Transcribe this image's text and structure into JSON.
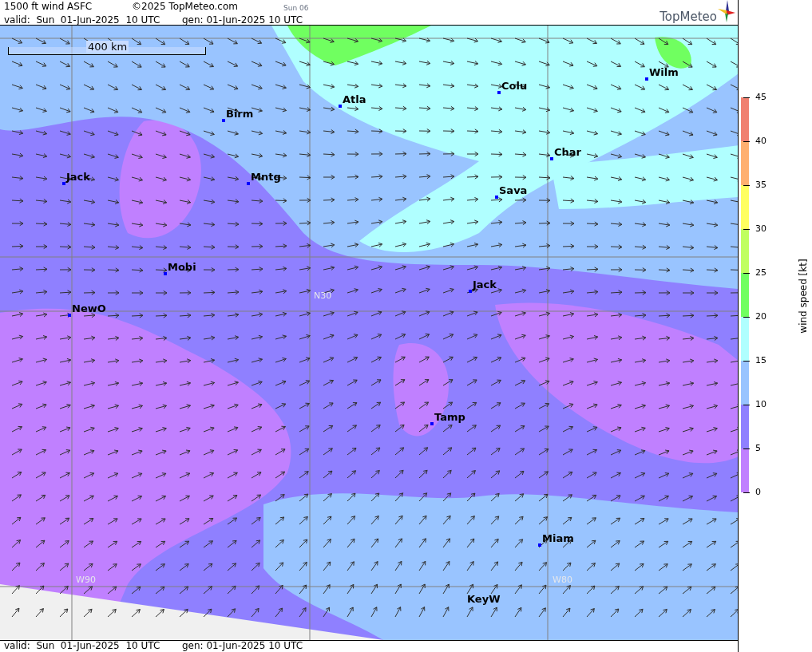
{
  "header": {
    "title": "1500 ft wind ASFC",
    "copyright": "©2025 TopMeteo.com",
    "run_label": "Sun 06",
    "valid": "valid:  Sun  01-Jun-2025  10 UTC",
    "generated": "gen: 01-Jun-2025 10 UTC",
    "logo_text": "TopMeteo"
  },
  "map": {
    "scale_label": "400 km",
    "grid_labels": [
      "N30",
      "W90",
      "W80"
    ],
    "cities": [
      {
        "name": "Birm",
        "marker": true
      },
      {
        "name": "Atla",
        "marker": true
      },
      {
        "name": "Colu",
        "marker": true
      },
      {
        "name": "Wilm",
        "marker": true
      },
      {
        "name": "Char",
        "marker": true
      },
      {
        "name": "Sava",
        "marker": true
      },
      {
        "name": "Jack",
        "marker": true
      },
      {
        "name": "Mntg",
        "marker": true
      },
      {
        "name": "Mobi",
        "marker": true
      },
      {
        "name": "Jack",
        "marker": true
      },
      {
        "name": "NewO",
        "marker": true
      },
      {
        "name": "Tamp",
        "marker": true
      },
      {
        "name": "Miam",
        "marker": true
      },
      {
        "name": "KeyW",
        "marker": false
      }
    ]
  },
  "legend": {
    "title": "wind speed [kt]",
    "ticks": [
      "45",
      "40",
      "35",
      "30",
      "25",
      "20",
      "15",
      "10",
      "5",
      "0"
    ],
    "bands": [
      {
        "color": "#f08070"
      },
      {
        "color": "#ffb070"
      },
      {
        "color": "#ffff60"
      },
      {
        "color": "#c0ff60"
      },
      {
        "color": "#70ff60"
      },
      {
        "color": "#b0ffff"
      },
      {
        "color": "#99c4ff"
      },
      {
        "color": "#8f80ff"
      },
      {
        "color": "#c080ff"
      }
    ]
  },
  "footer": {
    "valid": "valid:  Sun  01-Jun-2025  10 UTC",
    "generated": "gen: 01-Jun-2025 10 UTC"
  }
}
